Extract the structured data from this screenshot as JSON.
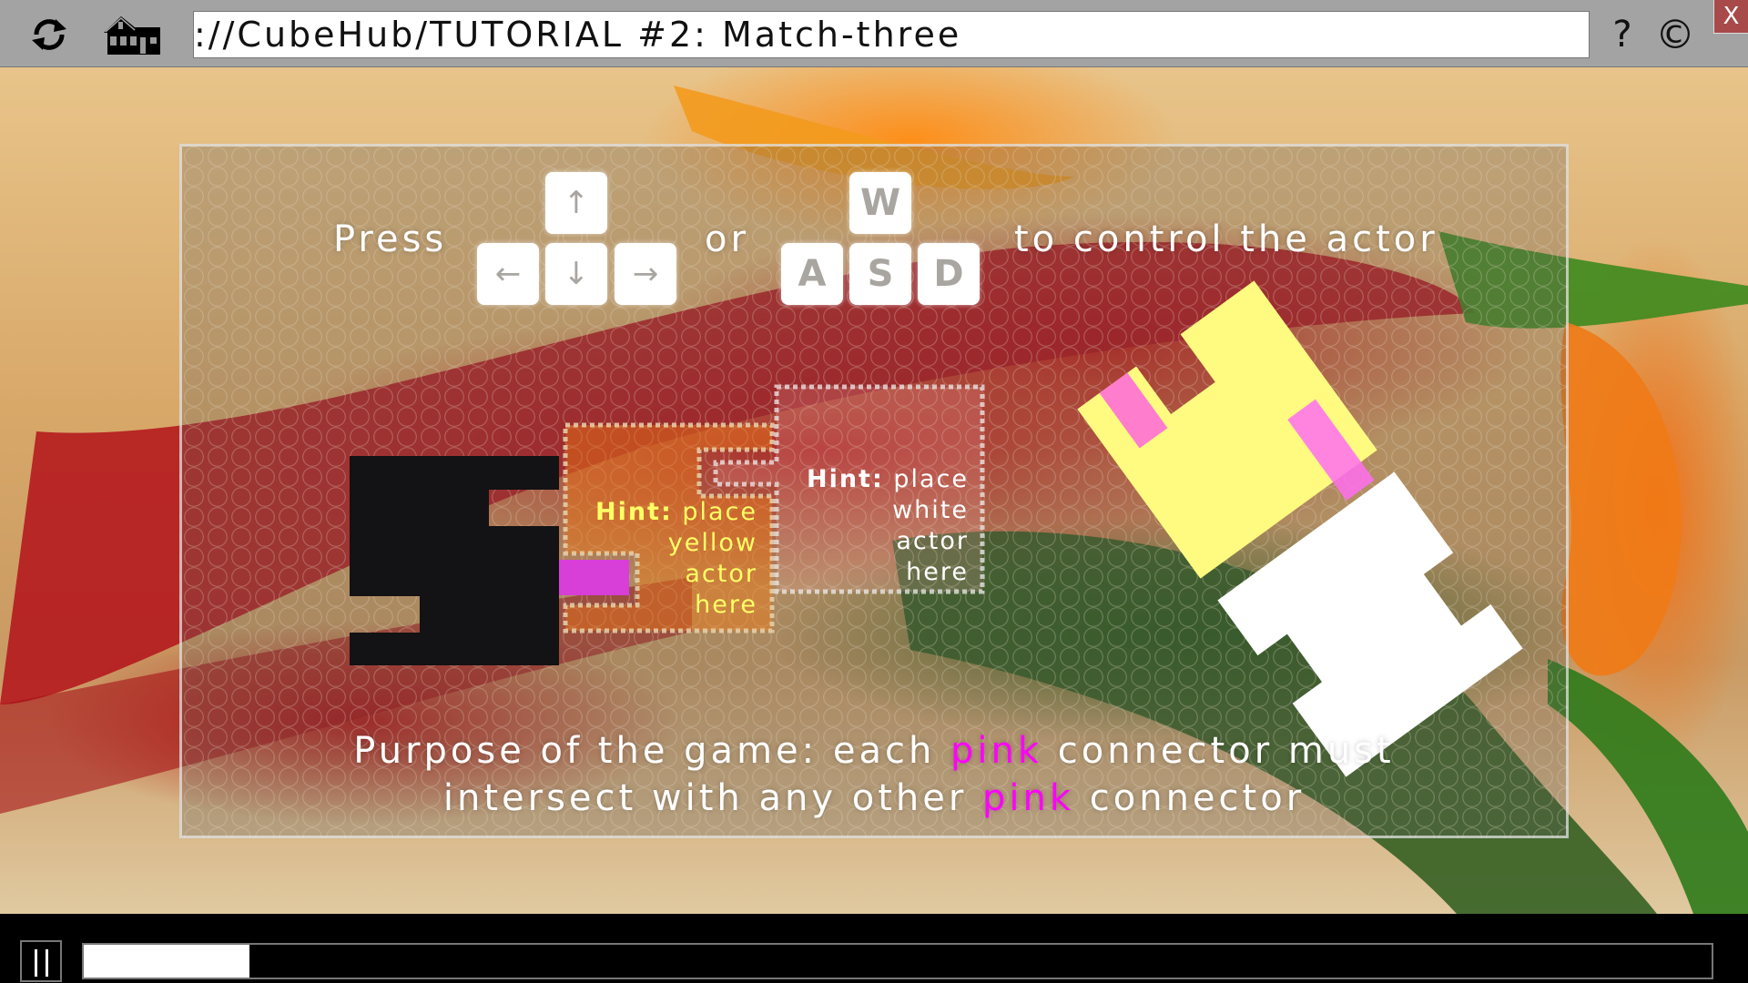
{
  "toolbar": {
    "refresh_icon": "refresh-icon",
    "home_icon": "house-icon",
    "address": "://CubeHub/TUTORIAL #2: Match-three",
    "help_label": "?",
    "copyright_label": "©",
    "close_label": "X"
  },
  "tutorial": {
    "press_label": "Press",
    "or_label": "or",
    "control_label": "to control the actor",
    "arrow_keys": {
      "up": "↑",
      "left": "←",
      "down": "↓",
      "right": "→"
    },
    "letter_keys": {
      "up": "W",
      "left": "A",
      "down": "S",
      "right": "D"
    },
    "hint_yellow": {
      "prefix": "Hint:",
      "lines": [
        "place",
        "yellow",
        "actor",
        "here"
      ]
    },
    "hint_white": {
      "prefix": "Hint:",
      "lines": [
        "place",
        "white",
        "actor",
        "here"
      ]
    },
    "purpose_line1_a": "Purpose of the game: each ",
    "purpose_line1_pink": "pink",
    "purpose_line1_b": " connector must",
    "purpose_line2_a": "intersect with any other ",
    "purpose_line2_pink": "pink",
    "purpose_line2_b": " connector"
  },
  "colors": {
    "pink_connector": "#ff00ff",
    "yellow_actor": "#fffb80",
    "white_actor": "#ffffff",
    "black_actor": "#131214",
    "hint_yellow_text": "#ffff66",
    "close_button": "#a84a4a"
  },
  "playback": {
    "pause_icon": "pause-icon",
    "progress_fraction": 0.102
  }
}
